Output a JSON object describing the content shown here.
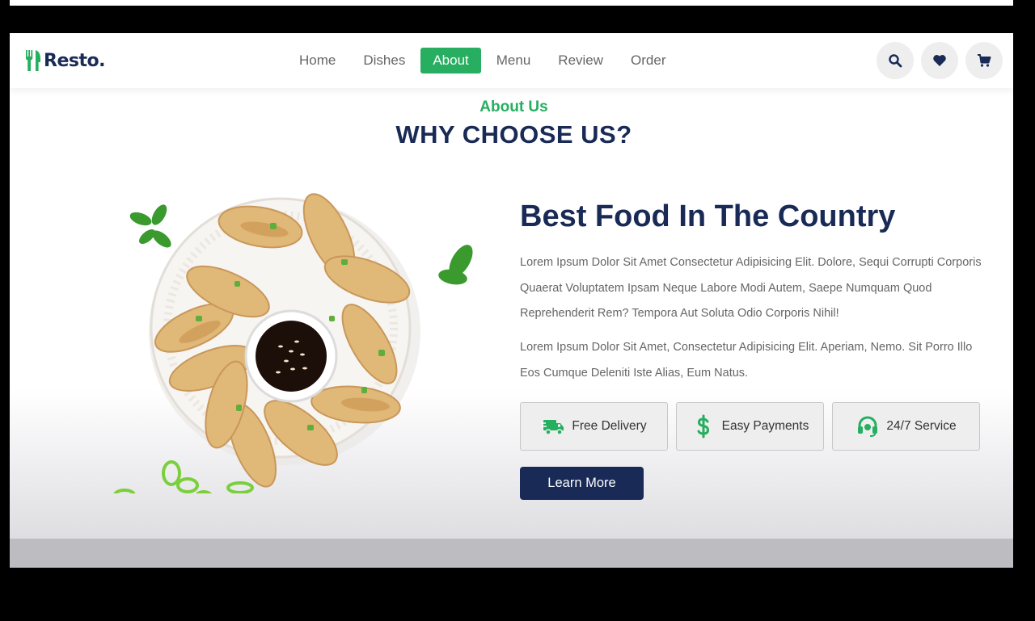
{
  "colors": {
    "accent": "#27ae60",
    "navy": "#192a56",
    "text": "#666666"
  },
  "logo": {
    "text": "Resto.",
    "icon": "utensils-icon"
  },
  "nav": {
    "items": [
      {
        "label": "Home",
        "active": false
      },
      {
        "label": "Dishes",
        "active": false
      },
      {
        "label": "About",
        "active": true
      },
      {
        "label": "Menu",
        "active": false
      },
      {
        "label": "Review",
        "active": false
      },
      {
        "label": "Order",
        "active": false
      }
    ]
  },
  "header_icons": [
    "search-icon",
    "heart-icon",
    "cart-icon"
  ],
  "about": {
    "sub_heading": "About Us",
    "heading": "WHY CHOOSE US?",
    "title": "Best Food In The Country",
    "paragraph_1": "Lorem Ipsum Dolor Sit Amet Consectetur Adipisicing Elit. Dolore, Sequi Corrupti Corporis Quaerat Voluptatem Ipsam Neque Labore Modi Autem, Saepe Numquam Quod Reprehenderit Rem? Tempora Aut Soluta Odio Corporis Nihil!",
    "paragraph_2": "Lorem Ipsum Dolor Sit Amet, Consectetur Adipisicing Elit. Aperiam, Nemo. Sit Porro Illo Eos Cumque Deleniti Iste Alias, Eum Natus.",
    "features": [
      {
        "icon": "truck-icon",
        "label": "Free Delivery"
      },
      {
        "icon": "dollar-icon",
        "label": "Easy Payments"
      },
      {
        "icon": "headset-icon",
        "label": "24/7 Service"
      }
    ],
    "button_label": "Learn More"
  }
}
